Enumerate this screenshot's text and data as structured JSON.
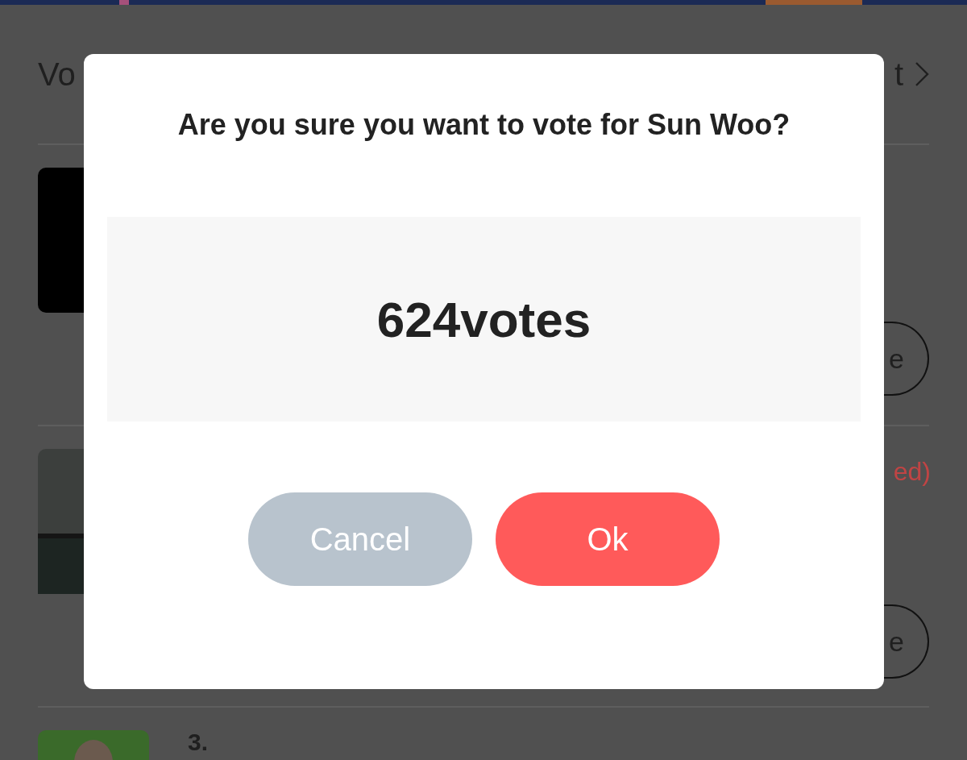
{
  "background": {
    "header": {
      "title": "Vo",
      "link": "t"
    },
    "rows": [
      {
        "kind": "logo",
        "button": "e"
      },
      {
        "status": "ed)",
        "button": "e"
      },
      {
        "kind": "portrait",
        "rank": "3."
      }
    ]
  },
  "dialog": {
    "message": "Are you sure you want to vote for Sun Woo?",
    "amount": "624votes",
    "buttons": [
      {
        "label": "Cancel",
        "kind": "secondary"
      },
      {
        "label": "Ok",
        "kind": "primary"
      }
    ]
  }
}
